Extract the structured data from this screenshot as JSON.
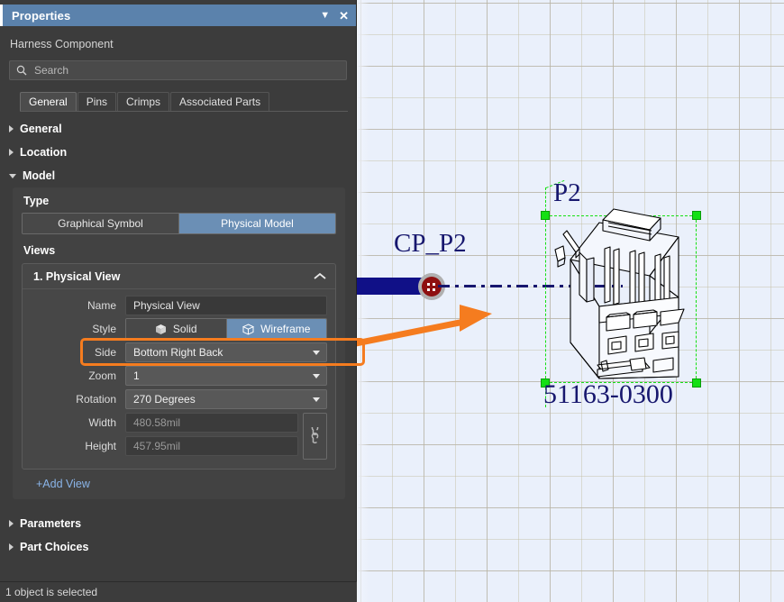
{
  "panel": {
    "titlebar": {
      "title": "Properties",
      "menu_icon": "chevron-down-icon",
      "close_icon": "close-icon"
    },
    "subtitle": "Harness Component",
    "search": {
      "icon": "search-icon",
      "placeholder": "Search",
      "value": ""
    },
    "tabs": [
      {
        "label": "General",
        "active": true
      },
      {
        "label": "Pins",
        "active": false
      },
      {
        "label": "Crimps",
        "active": false
      },
      {
        "label": "Associated Parts",
        "active": false
      }
    ],
    "sections": [
      {
        "label": "General",
        "expanded": false
      },
      {
        "label": "Location",
        "expanded": false
      },
      {
        "label": "Model",
        "expanded": true
      },
      {
        "label": "Parameters",
        "expanded": false
      },
      {
        "label": "Part Choices",
        "expanded": false
      }
    ],
    "model": {
      "type_label": "Type",
      "type_options": [
        {
          "label": "Graphical Symbol",
          "selected": false
        },
        {
          "label": "Physical Model",
          "selected": true
        }
      ],
      "views_label": "Views",
      "view": {
        "header": "1. Physical View",
        "collapse_icon": "chevron-up-icon",
        "fields": {
          "name_label": "Name",
          "name_value": "Physical View",
          "style_label": "Style",
          "style_options": [
            {
              "label": "Solid",
              "icon": "cube-solid-icon",
              "selected": false
            },
            {
              "label": "Wireframe",
              "icon": "cube-wireframe-icon",
              "selected": true
            }
          ],
          "side_label": "Side",
          "side_value": "Bottom Right Back",
          "zoom_label": "Zoom",
          "zoom_value": "1",
          "rotation_label": "Rotation",
          "rotation_value": "270 Degrees",
          "width_label": "Width",
          "width_value": "480.58mil",
          "height_label": "Height",
          "height_value": "457.95mil",
          "link_icon": "link-chain-icon"
        }
      },
      "add_view_label": "+Add View"
    },
    "statusbar": "1 object is selected"
  },
  "canvas": {
    "labels": {
      "designator": "P2",
      "connection_point": "CP_P2",
      "part_number": "51163-0300"
    },
    "elements": {
      "wire": "harness-wire",
      "connection_dot": "connection-point-marker",
      "centerline": "centerline-dash-dot",
      "selection_box": "selection-bounding-box",
      "connector": "connector-3d-wireframe",
      "annotation_arrow": "callout-arrow"
    }
  },
  "colors": {
    "titlebar": "#5b82ac",
    "accent_selected": "#6b8fb5",
    "highlight_orange": "#f57c1f",
    "panel_bg": "#3c3c3c",
    "canvas_bg": "#eaf0fb",
    "label_navy": "#17176e",
    "wire_navy": "#101087",
    "pin_red": "#8e1010",
    "selection_green": "#14e014",
    "link_blue": "#8ab4e8"
  }
}
